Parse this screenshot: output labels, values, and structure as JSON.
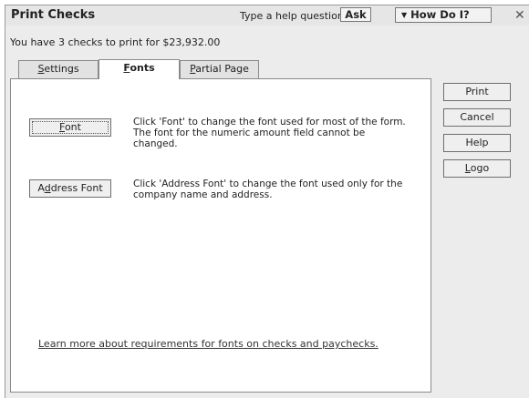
{
  "window": {
    "title": "Print Checks",
    "help_placeholder": "Type a help question",
    "ask_label": "Ask",
    "howdoi_label": "How Do I?",
    "close_glyph": "✕"
  },
  "status_text": "You have 3 checks to print for $23,932.00",
  "tabs": [
    {
      "pre": "",
      "ul": "S",
      "post": "ettings",
      "active": false
    },
    {
      "pre": "",
      "ul": "F",
      "post": "onts",
      "active": true
    },
    {
      "pre": "",
      "ul": "P",
      "post": "artial Page",
      "active": false
    }
  ],
  "fonts_tab": {
    "font_button": {
      "pre": "",
      "ul": "F",
      "post": "ont"
    },
    "font_desc_lines": [
      "Click 'Font' to change the font used for most of the form.",
      "The font for the numeric amount field cannot be",
      "changed."
    ],
    "address_button": {
      "pre": "A",
      "ul": "d",
      "post": "dress Font"
    },
    "address_desc_lines": [
      "Click 'Address Font' to change the font used only for the",
      "company name and address."
    ],
    "learn_more_link": "Learn more about requirements for fonts on checks and paychecks."
  },
  "side_buttons": {
    "print": {
      "pre": "Print",
      "ul": "",
      "post": ""
    },
    "cancel": {
      "pre": "Cancel",
      "ul": "",
      "post": ""
    },
    "help": {
      "pre": "Help",
      "ul": "",
      "post": ""
    },
    "logo": {
      "pre": "",
      "ul": "L",
      "post": "ogo"
    }
  },
  "colors": {
    "window_bg": "#ececec",
    "panel_bg": "#ffffff",
    "border": "#8a8a8a"
  }
}
